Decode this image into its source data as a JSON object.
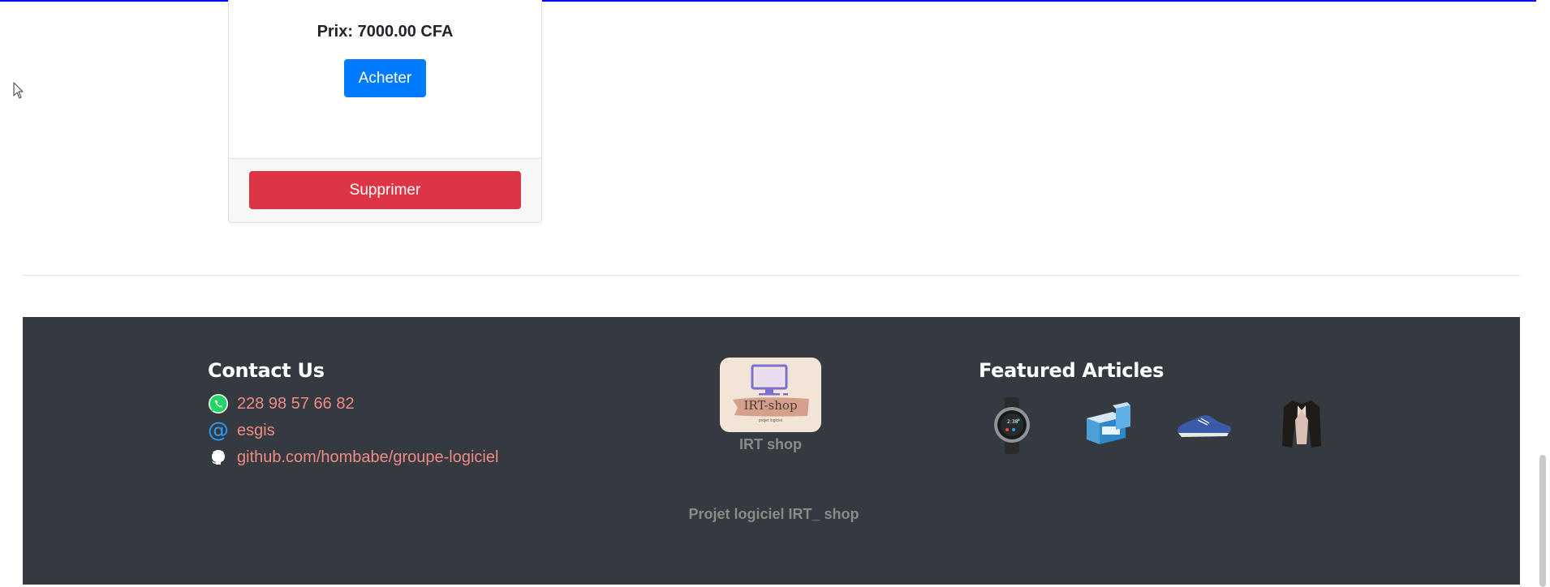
{
  "product": {
    "price_text": "Prix: 7000.00 CFA",
    "buy_label": "Acheter",
    "delete_label": "Supprimer"
  },
  "footer": {
    "contact": {
      "title": "Contact Us",
      "phone": "228 98 57 66 82",
      "email": "esgis",
      "github": "github.com/hombabe/groupe-logiciel"
    },
    "logo": {
      "brand_text": "IRT-shop",
      "tagline": "projet logiciel",
      "caption": "IRT shop"
    },
    "featured": {
      "title": "Featured Articles",
      "items": [
        "smartwatch-image",
        "pills-box-image",
        "blue-sneaker-image",
        "black-jacket-image"
      ]
    },
    "bottom_text": "Projet logiciel IRT_ shop"
  },
  "colors": {
    "top_line": "#0000ff",
    "primary": "#007bff",
    "danger": "#dc3545",
    "footer_bg": "#343a40",
    "link": "#f08a86",
    "muted": "#8a8a8a"
  },
  "icons": [
    "cursor-icon",
    "whatsapp-icon",
    "at-icon",
    "github-icon"
  ]
}
